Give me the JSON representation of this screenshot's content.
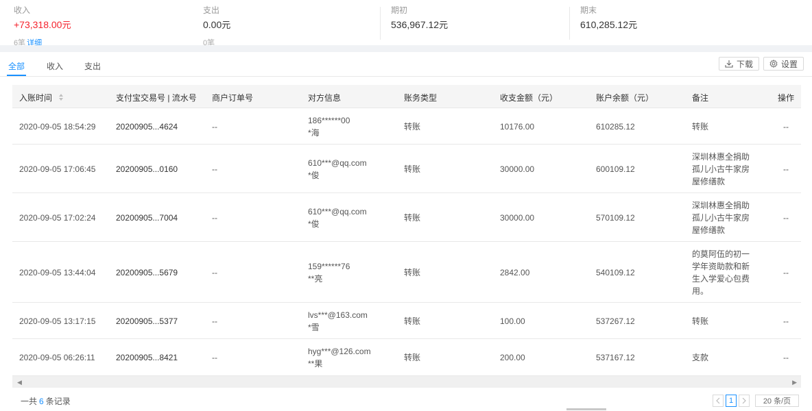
{
  "summary": {
    "income": {
      "label": "收入",
      "value": "+73,318.00",
      "unit": "元",
      "count": "6笔",
      "detail_link": "详细"
    },
    "expense": {
      "label": "支出",
      "value": "0.00",
      "unit": "元",
      "count": "0笔"
    },
    "opening": {
      "label": "期初",
      "value": "536,967.12",
      "unit": "元"
    },
    "closing": {
      "label": "期末",
      "value": "610,285.12",
      "unit": "元"
    },
    "colors": {
      "income": "#f5222d",
      "accent": "#1890ff"
    }
  },
  "tabs": [
    {
      "label": "全部",
      "active": true
    },
    {
      "label": "收入",
      "active": false
    },
    {
      "label": "支出",
      "active": false
    }
  ],
  "toolbar": {
    "download_label": "下载",
    "download_icon": "download-icon",
    "settings_label": "设置",
    "settings_icon": "gear-icon"
  },
  "table": {
    "columns": [
      "入账时间",
      "支付宝交易号 | 流水号",
      "商户订单号",
      "对方信息",
      "账务类型",
      "收支金额（元）",
      "账户余额（元）",
      "备注",
      "操作"
    ],
    "rows": [
      {
        "time": "2020-09-05 18:54:29",
        "trade_no": "20200905...4624",
        "order_no": "--",
        "counterparty": "186******00",
        "counterparty_name": "*海",
        "type": "转账",
        "amount": "10176.00",
        "balance": "610285.12",
        "remark": "转账",
        "action": "--"
      },
      {
        "time": "2020-09-05 17:06:45",
        "trade_no": "20200905...0160",
        "order_no": "--",
        "counterparty": "610***@qq.com",
        "counterparty_name": "*俊",
        "type": "转账",
        "amount": "30000.00",
        "balance": "600109.12",
        "remark": "深圳林惠全捐助孤儿小古牛家房屋修缮款",
        "action": "--"
      },
      {
        "time": "2020-09-05 17:02:24",
        "trade_no": "20200905...7004",
        "order_no": "--",
        "counterparty": "610***@qq.com",
        "counterparty_name": "*俊",
        "type": "转账",
        "amount": "30000.00",
        "balance": "570109.12",
        "remark": "深圳林惠全捐助孤儿小古牛家房屋修缮款",
        "action": "--"
      },
      {
        "time": "2020-09-05 13:44:04",
        "trade_no": "20200905...5679",
        "order_no": "--",
        "counterparty": "159******76",
        "counterparty_name": "**亮",
        "type": "转账",
        "amount": "2842.00",
        "balance": "540109.12",
        "remark": "的莫阿伍的初一学年资助款和新生入学爱心包费用。",
        "action": "--"
      },
      {
        "time": "2020-09-05 13:17:15",
        "trade_no": "20200905...5377",
        "order_no": "--",
        "counterparty": "lvs***@163.com",
        "counterparty_name": "*雪",
        "type": "转账",
        "amount": "100.00",
        "balance": "537267.12",
        "remark": "转账",
        "action": "--"
      },
      {
        "time": "2020-09-05 06:26:11",
        "trade_no": "20200905...8421",
        "order_no": "--",
        "counterparty": "hyg***@126.com",
        "counterparty_name": "**果",
        "type": "转账",
        "amount": "200.00",
        "balance": "537167.12",
        "remark": "支款",
        "action": "--"
      }
    ]
  },
  "footer": {
    "total_prefix": "一共",
    "total_count": "6",
    "total_suffix": "条记录",
    "prev_icon": "chevron-left-icon",
    "current_page": "1",
    "next_icon": "chevron-right-icon",
    "page_size": "20 条/页"
  }
}
